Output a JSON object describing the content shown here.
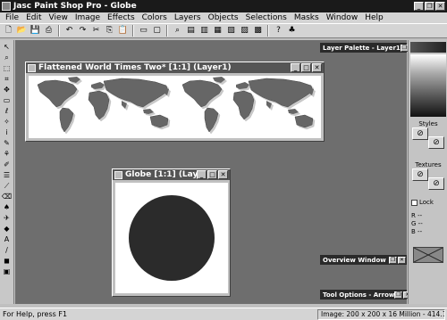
{
  "app": {
    "title": "Jasc Paint Shop Pro - Globe",
    "window_buttons": [
      "_",
      "❐",
      "✕"
    ]
  },
  "menu": [
    "File",
    "Edit",
    "View",
    "Image",
    "Effects",
    "Colors",
    "Layers",
    "Objects",
    "Selections",
    "Masks",
    "Window",
    "Help"
  ],
  "toolbar": {
    "icons": [
      "new-icon",
      "open-icon",
      "save-icon",
      "print-icon",
      "undo-icon",
      "redo-icon",
      "cut-icon",
      "copy-icon",
      "paste-icon",
      "full-screen-preview-icon",
      "normal-viewing-icon",
      "zoom-icon",
      "toggle-tool-palette-icon",
      "toggle-color-palette-icon",
      "histogram-icon",
      "layer-palette-icon",
      "overview-icon",
      "tool-options-icon",
      "help-icon",
      "jasc-icon"
    ]
  },
  "tools": [
    "arrow-tool-icon",
    "zoom-tool-icon",
    "deformation-tool-icon",
    "crop-tool-icon",
    "mover-tool-icon",
    "selection-tool-icon",
    "freehand-tool-icon",
    "magic-wand-icon",
    "dropper-icon",
    "paintbrush-icon",
    "clone-brush-icon",
    "color-replacer-icon",
    "retouch-icon",
    "scratch-remover-icon",
    "eraser-icon",
    "picture-tube-icon",
    "airbrush-icon",
    "flood-fill-icon",
    "text-tool-icon",
    "draw-tool-icon",
    "preset-shapes-icon",
    "object-selector-icon"
  ],
  "windows": {
    "map": {
      "title": "Flattened World Times Two* [1:1] (Layer1)"
    },
    "globe": {
      "title": "Globe [1:1] (Lay..."
    }
  },
  "palettes": {
    "layer": "Layer Palette - Layer1",
    "overview": "Overview Window",
    "tool_options": "Tool Options - Arrow"
  },
  "color_panel": {
    "styles_label": "Styles",
    "textures_label": "Textures",
    "lock_label": "Lock",
    "rgb": [
      {
        "channel": "R",
        "value": "--"
      },
      {
        "channel": "G",
        "value": "--"
      },
      {
        "channel": "B",
        "value": "--"
      }
    ]
  },
  "status": {
    "help_text": "For Help, press F1",
    "image_info": "Image:  200 x 200 x 16 Million - 414.1 KBytes"
  },
  "colors": {
    "globe_fill": "#2b2b2b",
    "workspace": "#6e6e6e",
    "title_active": "#1a1a1a"
  }
}
